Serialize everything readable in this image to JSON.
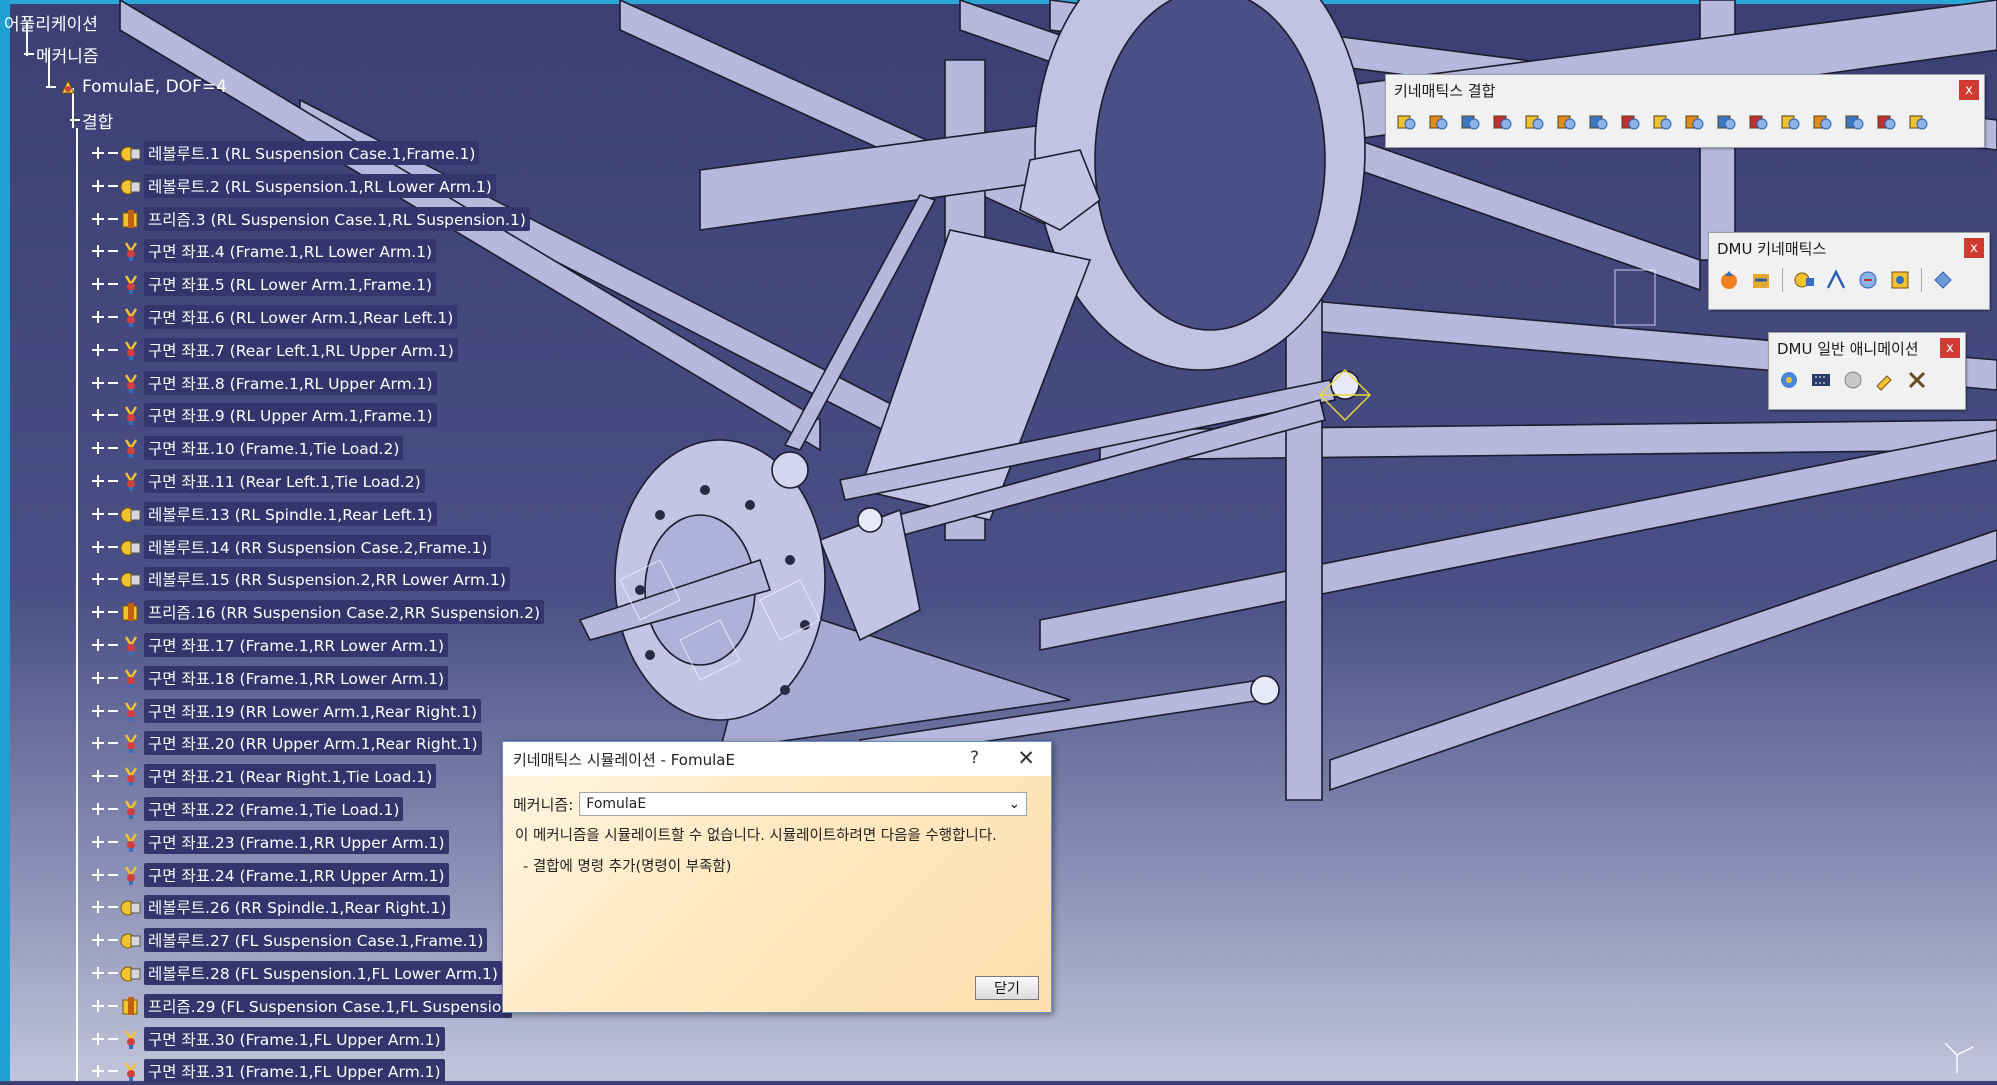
{
  "tree": {
    "root": "어플리케이션",
    "mechanisms": "메커니즘",
    "mechanism": "FomulaE, DOF=4",
    "joints_label": "결합",
    "joints": [
      "레볼루트.1 (RL Suspension Case.1,Frame.1)",
      "레볼루트.2 (RL Suspension.1,RL Lower Arm.1)",
      "프리즘.3 (RL Suspension Case.1,RL Suspension.1)",
      "구면 좌표.4 (Frame.1,RL Lower Arm.1)",
      "구면 좌표.5 (RL Lower Arm.1,Frame.1)",
      "구면 좌표.6 (RL Lower Arm.1,Rear Left.1)",
      "구면 좌표.7 (Rear Left.1,RL Upper Arm.1)",
      "구면 좌표.8 (Frame.1,RL Upper Arm.1)",
      "구면 좌표.9 (RL Upper Arm.1,Frame.1)",
      "구면 좌표.10 (Frame.1,Tie Load.2)",
      "구면 좌표.11 (Rear Left.1,Tie Load.2)",
      "레볼루트.13 (RL Spindle.1,Rear Left.1)",
      "레볼루트.14 (RR Suspension Case.2,Frame.1)",
      "레볼루트.15 (RR Suspension.2,RR Lower Arm.1)",
      "프리즘.16 (RR Suspension Case.2,RR Suspension.2)",
      "구면 좌표.17 (Frame.1,RR Lower Arm.1)",
      "구면 좌표.18 (Frame.1,RR Lower Arm.1)",
      "구면 좌표.19 (RR Lower Arm.1,Rear Right.1)",
      "구면 좌표.20 (RR Upper Arm.1,Rear Right.1)",
      "구면 좌표.21 (Rear Right.1,Tie Load.1)",
      "구면 좌표.22 (Frame.1,Tie Load.1)",
      "구면 좌표.23 (Frame.1,RR Upper Arm.1)",
      "구면 좌표.24 (Frame.1,RR Upper Arm.1)",
      "레볼루트.26 (RR Spindle.1,Rear Right.1)",
      "레볼루트.27 (FL Suspension Case.1,Frame.1)",
      "레볼루트.28 (FL Suspension.1,FL Lower Arm.1)",
      "프리즘.29 (FL Suspension Case.1,FL Suspensior",
      "구면 좌표.30 (Frame.1,FL Upper Arm.1)",
      "구면 좌표.31 (Frame.1,FL Upper Arm.1)"
    ],
    "joint_types": [
      "revolute",
      "revolute",
      "prismatic",
      "spherical",
      "spherical",
      "spherical",
      "spherical",
      "spherical",
      "spherical",
      "spherical",
      "spherical",
      "revolute",
      "revolute",
      "revolute",
      "prismatic",
      "spherical",
      "spherical",
      "spherical",
      "spherical",
      "spherical",
      "spherical",
      "spherical",
      "spherical",
      "revolute",
      "revolute",
      "revolute",
      "prismatic",
      "spherical",
      "spherical"
    ]
  },
  "toolbars": {
    "kinematics_joints": {
      "title": "키네매틱스 결합",
      "close": "x",
      "icon_count": 17
    },
    "dmu_kinematics": {
      "title": "DMU 키네매틱스",
      "close": "x"
    },
    "dmu_animation": {
      "title": "DMU 일반 애니메이션",
      "close": "x"
    }
  },
  "dialog": {
    "title": "키네매틱스 시뮬레이션 - FomulaE",
    "help": "?",
    "close": "✕",
    "mechanism_label": "메커니즘:",
    "mechanism_value": "FomulaE",
    "message": "이 메커니즘을 시뮬레이트할 수 없습니다. 시뮬레이트하려면 다음을 수행합니다.",
    "bullet": "- 결합에 명령 추가(명령이 부족함)",
    "close_button": "닫기"
  },
  "colors": {
    "background_top": "#3b3f73",
    "background_bottom": "#c2c5da",
    "part_fill": "#b7b8dc",
    "part_edge": "#1c1c2e",
    "dialog_bg": "#ffe9c2",
    "toolbar_close": "#d13a32"
  }
}
